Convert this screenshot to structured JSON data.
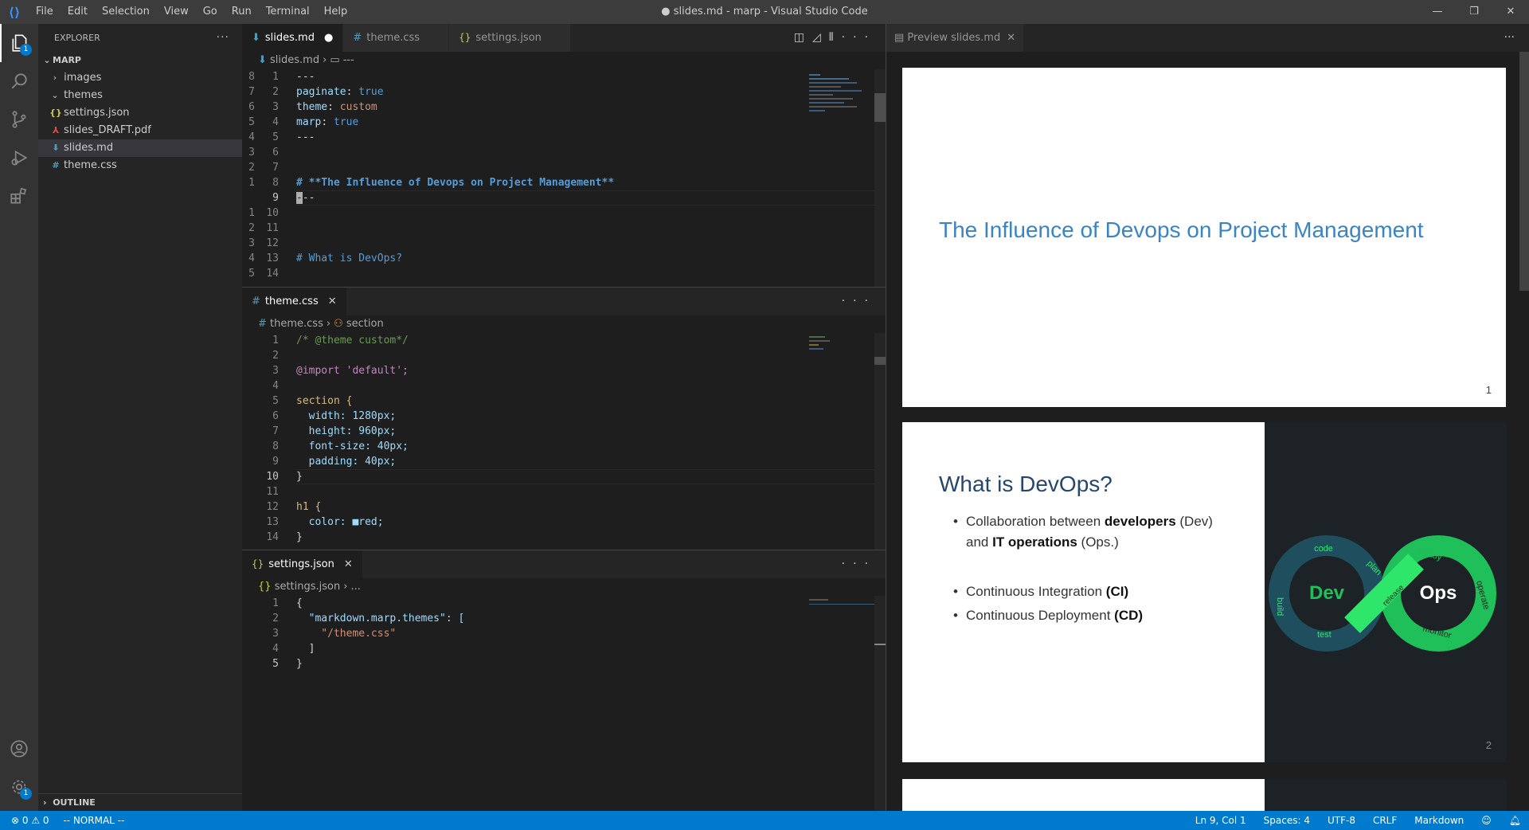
{
  "window": {
    "title": "● slides.md - marp - Visual Studio Code"
  },
  "menu": [
    "File",
    "Edit",
    "Selection",
    "View",
    "Go",
    "Run",
    "Terminal",
    "Help"
  ],
  "window_buttons": {
    "minimize": "—",
    "restore": "❐",
    "close": "✕"
  },
  "activity": {
    "explorer_badge": "1",
    "settings_badge": "1"
  },
  "sidebar": {
    "title": "EXPLORER",
    "more": "···",
    "root": "MARP",
    "items": [
      {
        "label": "images",
        "kind": "folder",
        "chev": "›"
      },
      {
        "label": "themes",
        "kind": "folder",
        "chev": "⌄"
      },
      {
        "label": "settings.json",
        "kind": "json",
        "icon": "{}"
      },
      {
        "label": "slides_DRAFT.pdf",
        "kind": "pdf",
        "icon": "⅄"
      },
      {
        "label": "slides.md",
        "kind": "md",
        "icon": "⬇"
      },
      {
        "label": "theme.css",
        "kind": "css",
        "icon": "#"
      }
    ],
    "outline": "OUTLINE"
  },
  "editor1": {
    "tabs": [
      {
        "label": "slides.md",
        "icon": "⬇",
        "marker": "●",
        "active": true
      },
      {
        "label": "theme.css",
        "icon": "#"
      },
      {
        "label": "settings.json",
        "icon": "{}"
      }
    ],
    "breadcrumb": {
      "file": "slides.md",
      "sep": "›",
      "item": "---"
    },
    "lines": [
      {
        "rel": "8",
        "num": "1",
        "text": "---"
      },
      {
        "rel": "7",
        "num": "2",
        "key": "paginate",
        "val": "true"
      },
      {
        "rel": "6",
        "num": "3",
        "key": "theme",
        "val": "custom",
        "str": true
      },
      {
        "rel": "5",
        "num": "4",
        "key": "marp",
        "val": "true"
      },
      {
        "rel": "4",
        "num": "5",
        "text": "---"
      },
      {
        "rel": "3",
        "num": "6",
        "text": ""
      },
      {
        "rel": "2",
        "num": "7",
        "text": ""
      },
      {
        "rel": "1",
        "num": "8",
        "head": "# **The Influence of Devops on Project Management**"
      },
      {
        "rel": "",
        "num": "9",
        "text": "---",
        "cursor": true
      },
      {
        "rel": "1",
        "num": "10",
        "text": ""
      },
      {
        "rel": "2",
        "num": "11",
        "text": ""
      },
      {
        "rel": "3",
        "num": "12",
        "text": ""
      },
      {
        "rel": "4",
        "num": "13",
        "head": "# What is DevOps?"
      },
      {
        "rel": "5",
        "num": "14",
        "text": ""
      }
    ]
  },
  "editor2": {
    "tab": "theme.css",
    "breadcrumb": {
      "file": "theme.css",
      "sep": "›",
      "item": "section"
    },
    "lines": [
      {
        "num": "1",
        "text": "/* @theme custom*/",
        "cls": "c"
      },
      {
        "num": "2",
        "text": ""
      },
      {
        "num": "3",
        "text": "@import 'default';",
        "cls": "at"
      },
      {
        "num": "4",
        "text": ""
      },
      {
        "num": "5",
        "text": "section {",
        "cls": "sel2"
      },
      {
        "num": "6",
        "text": "  width: 1280px;",
        "cls": "prop"
      },
      {
        "num": "7",
        "text": "  height: 960px;",
        "cls": "prop"
      },
      {
        "num": "8",
        "text": "  font-size: 40px;",
        "cls": "prop"
      },
      {
        "num": "9",
        "text": "  padding: 40px;",
        "cls": "prop"
      },
      {
        "num": "10",
        "text": "}",
        "cur": true
      },
      {
        "num": "11",
        "text": ""
      },
      {
        "num": "12",
        "text": "h1 {",
        "cls": "sel2"
      },
      {
        "num": "13",
        "text": "  color: ■red;",
        "cls": "prop"
      },
      {
        "num": "14",
        "text": "}"
      }
    ]
  },
  "editor3": {
    "tab": "settings.json",
    "breadcrumb": {
      "file": "settings.json",
      "sep": "›",
      "item": "..."
    },
    "lines": [
      {
        "num": "1",
        "text": "{"
      },
      {
        "num": "2",
        "text": "  \"markdown.marp.themes\": ["
      },
      {
        "num": "3",
        "text": "    \"/theme.css\""
      },
      {
        "num": "4",
        "text": "  ]"
      },
      {
        "num": "5",
        "text": "}",
        "cur": true
      }
    ]
  },
  "preview": {
    "tab": "Preview slides.md",
    "slide1": {
      "title": "The Influence of Devops on Project Management",
      "page": "1"
    },
    "slide2": {
      "title": "What is DevOps?",
      "b1a": "Collaboration between ",
      "b1b": "developers",
      "b1c": " (Dev)",
      "b1d": "and ",
      "b1e": "IT operations",
      "b1f": " (Ops.)",
      "b2a": "Continuous Integration ",
      "b2b": "(CI)",
      "b3a": "Continuous Deployment ",
      "b3b": "(CD)",
      "page": "2",
      "logo": {
        "dev": "Dev",
        "ops": "Ops",
        "words": [
          "code",
          "plan",
          "build",
          "test",
          "release",
          "deploy",
          "operate",
          "monitor"
        ]
      }
    }
  },
  "status": {
    "errors": "⊗ 0 ⚠ 0",
    "mode": "-- NORMAL --",
    "position": "Ln 9, Col 1",
    "spaces": "Spaces: 4",
    "encoding": "UTF-8",
    "eol": "CRLF",
    "lang": "Markdown"
  }
}
